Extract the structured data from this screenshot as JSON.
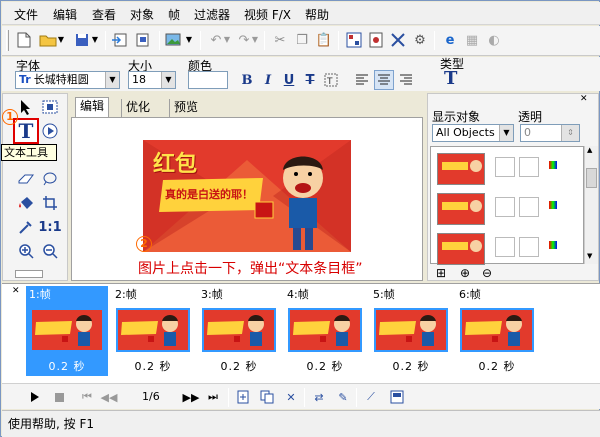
{
  "menubar": {
    "items": [
      "文件",
      "编辑",
      "查看",
      "对象",
      "帧",
      "过滤器",
      "视频 F/X",
      "帮助"
    ]
  },
  "props": {
    "font_label": "字体",
    "font_value": "长城特粗圆",
    "size_label": "大小",
    "size_value": "18",
    "color_label": "颜色",
    "type_label": "类型",
    "bold": "B",
    "italic": "I",
    "underline": "U",
    "strike": "T",
    "type_icon": "T"
  },
  "tools": {
    "text_tool": "T",
    "tooltip": "文本工具",
    "ratio": "1:1"
  },
  "tabs": [
    "编辑",
    "优化",
    "预览"
  ],
  "canvas": {
    "banner_title": "红包",
    "banner_subtitle": "真的是白送的耶！",
    "instruction": "图片上点击一下，弹出“文本条目框”"
  },
  "callouts": {
    "one": "1",
    "two": "2"
  },
  "rightpanel": {
    "display_label": "显示对象",
    "display_value": "All Objects",
    "opacity_label": "透明",
    "opacity_value": "0"
  },
  "timeline": {
    "frames": [
      {
        "label": "1:帧",
        "time": "0.2 秒"
      },
      {
        "label": "2:帧",
        "time": "0.2 秒"
      },
      {
        "label": "3:帧",
        "time": "0.2 秒"
      },
      {
        "label": "4:帧",
        "time": "0.2 秒"
      },
      {
        "label": "5:帧",
        "time": "0.2 秒"
      },
      {
        "label": "6:帧",
        "time": "0.2 秒"
      }
    ]
  },
  "playbar": {
    "page": "1/6"
  },
  "status": {
    "text": "使用帮助, 按 F1"
  },
  "colors": {
    "accent": "#3399ff",
    "callout": "#ff6a00",
    "instruction": "#d80000",
    "banner_bg": "#e8463a"
  }
}
